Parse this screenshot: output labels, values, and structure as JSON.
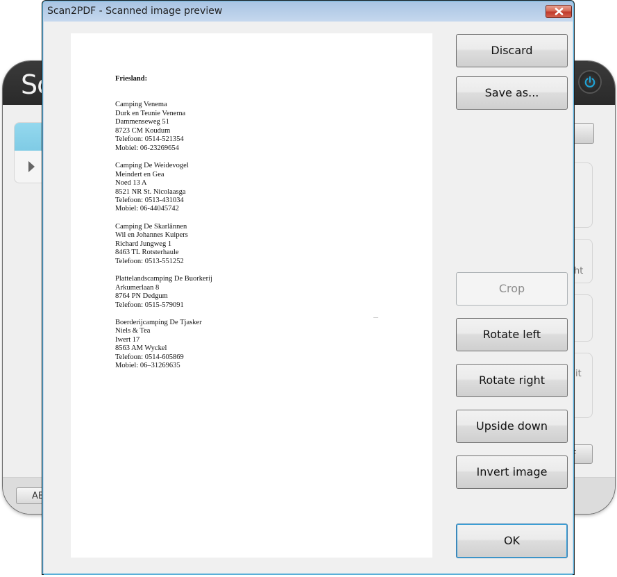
{
  "background_app": {
    "title_partial": "Sc",
    "left_button_partial": "AB",
    "right_text_partial_1": "ht",
    "right_text_partial_2": "it",
    "right_button_partial": "F"
  },
  "dialog": {
    "title": "Scan2PDF - Scanned image preview",
    "close_label": "×"
  },
  "buttons": {
    "discard": "Discard",
    "save_as": "Save as...",
    "crop": "Crop",
    "rotate_left": "Rotate left",
    "rotate_right": "Rotate right",
    "upside_down": "Upside down",
    "invert_image": "Invert image",
    "ok": "OK"
  },
  "document": {
    "heading": "Friesland:",
    "entries": [
      {
        "lines": [
          "Camping Venema",
          "Durk en Teunie Venema",
          "Dammenseweg 51",
          "8723 CM Koudum",
          "Telefoon: 0514-521354",
          "Mobiel: 06-23269654"
        ]
      },
      {
        "lines": [
          "Camping De Weidevogel",
          "Meindert en Gea",
          "Noed 13 A",
          "8521 NR St. Nicolaasga",
          "Telefoon: 0513-431034",
          "Mobiel: 06-44045742"
        ]
      },
      {
        "lines": [
          "Camping De Skarlânnen",
          "Wil en Johannes Kuipers",
          "Richard Jungweg 1",
          "8463 TL Rotsterhaule",
          "Telefoon: 0513-551252"
        ]
      },
      {
        "lines": [
          "Plattelandscamping De Buorkerij",
          "Arkumerlaan 8",
          "8764 PN Dedgum",
          "Telefoon: 0515-579091"
        ]
      },
      {
        "lines": [
          "Boerderijcamping De Tjasker",
          "Niels & Tea",
          "Iwert 17",
          "8563 AM Wyckel",
          "Telefoon: 0514-605869",
          "Mobiel: 06–31269635"
        ]
      }
    ]
  }
}
